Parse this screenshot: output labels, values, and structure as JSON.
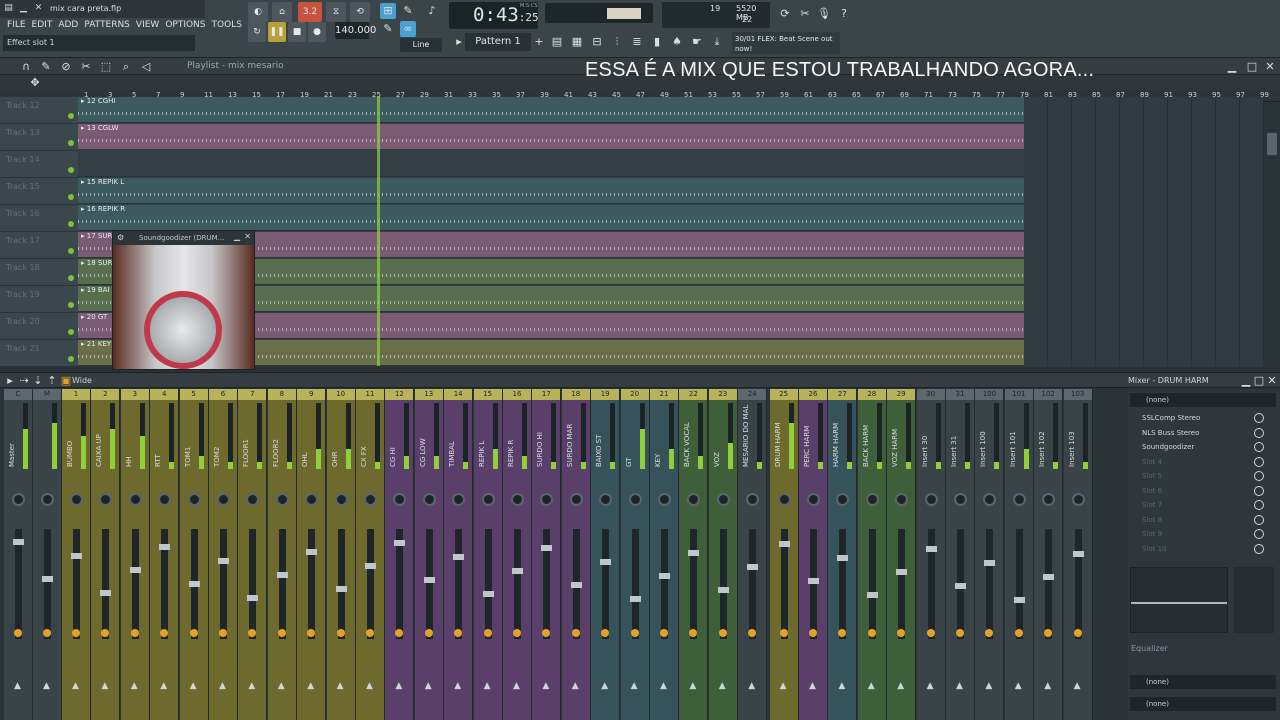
{
  "window": {
    "title": "mix cara preta.flp"
  },
  "menu": [
    "FILE",
    "EDIT",
    "ADD",
    "PATTERNS",
    "VIEW",
    "OPTIONS",
    "TOOLS",
    "?"
  ],
  "hint_bar": "Effect slot 1",
  "transport": {
    "time": "0:43",
    "time_frac": "25",
    "time_unit": "M:S:CS",
    "tempo": "140.000",
    "pattern": "Pattern 1",
    "snap": "Line",
    "step": "3.2"
  },
  "cpu": {
    "value": "19",
    "memory": "5520 MB",
    "polyphony": "22"
  },
  "hint_right": {
    "line1": "30/01 FLEX: Beat Scene out",
    "line2": "now!"
  },
  "playlist": {
    "title": "Playlist - mix mesario",
    "ruler": [
      "1",
      "3",
      "5",
      "7",
      "9",
      "11",
      "13",
      "15",
      "17",
      "19",
      "21",
      "23",
      "25",
      "27",
      "29",
      "31",
      "33",
      "35",
      "37",
      "39",
      "41",
      "43",
      "45",
      "47",
      "49",
      "51",
      "53",
      "55",
      "57",
      "59",
      "61",
      "63",
      "65",
      "67",
      "69",
      "71",
      "73",
      "75",
      "77",
      "79",
      "81",
      "83",
      "85",
      "87",
      "89",
      "91",
      "93",
      "95",
      "97",
      "99"
    ],
    "tracks": [
      {
        "name": "Track 12",
        "clip": "12 CGHI",
        "color": "#3c5a5f"
      },
      {
        "name": "Track 13",
        "clip": "13 CGLW",
        "color": "#7a5b73"
      },
      {
        "name": "Track 14",
        "clip": "",
        "color": "#324046"
      },
      {
        "name": "Track 15",
        "clip": "15 REPIK L",
        "color": "#3c5a5f"
      },
      {
        "name": "Track 16",
        "clip": "16 REPIK R",
        "color": "#3c5a5f"
      },
      {
        "name": "Track 17",
        "clip": "17 SUR",
        "color": "#7a5b73"
      },
      {
        "name": "Track 18",
        "clip": "18 SUR",
        "color": "#596e4f"
      },
      {
        "name": "Track 19",
        "clip": "19 BAI",
        "color": "#596e4f"
      },
      {
        "name": "Track 20",
        "clip": "20 GT",
        "color": "#7a5b73"
      },
      {
        "name": "Track 21",
        "clip": "21 KEY",
        "color": "#6a6e4a"
      }
    ]
  },
  "overlay_text": "ESSA É A MIX QUE ESTOU TRABALHANDO AGORA...",
  "plugin": {
    "title": "Soundgoodizer (DRUM..."
  },
  "mixer": {
    "mode": "Wide",
    "title": "Mixer - DRUM HARM",
    "selected": "(none)",
    "bottom": "(none)",
    "eq_label": "Equalizer",
    "slot_none": "(none)",
    "slots": [
      {
        "name": "SSLComp Stereo",
        "on": true
      },
      {
        "name": "NLS Buss Stereo",
        "on": true
      },
      {
        "name": "Soundgoodizer",
        "on": true
      },
      {
        "name": "Slot 4",
        "on": false
      },
      {
        "name": "Slot 5",
        "on": false
      },
      {
        "name": "Slot 6",
        "on": false
      },
      {
        "name": "Slot 7",
        "on": false
      },
      {
        "name": "Slot 8",
        "on": false
      },
      {
        "name": "Slot 9",
        "on": false
      },
      {
        "name": "Slot 10",
        "on": false
      }
    ],
    "strips": [
      {
        "n": "C",
        "name": "Master",
        "color": "#3a4348",
        "level": 0.6
      },
      {
        "n": "M",
        "name": "",
        "color": "#3a4348",
        "level": 0.7
      },
      {
        "n": "1",
        "name": "BUMBO",
        "color": "#6e6a2e",
        "level": 0.5
      },
      {
        "n": "2",
        "name": "CAIXA UP",
        "color": "#6e6a2e",
        "level": 0.6
      },
      {
        "n": "3",
        "name": "HH",
        "color": "#6e6a2e",
        "level": 0.5
      },
      {
        "n": "4",
        "name": "RTT",
        "color": "#6e6a2e",
        "level": 0.1
      },
      {
        "n": "5",
        "name": "TOM1",
        "color": "#6e6a2e",
        "level": 0.2
      },
      {
        "n": "6",
        "name": "TOM2",
        "color": "#6e6a2e",
        "level": 0.1
      },
      {
        "n": "7",
        "name": "FLOOR1",
        "color": "#6e6a2e",
        "level": 0.1
      },
      {
        "n": "8",
        "name": "FLOOR2",
        "color": "#6e6a2e",
        "level": 0.1
      },
      {
        "n": "9",
        "name": "OHL",
        "color": "#6e6a2e",
        "level": 0.3
      },
      {
        "n": "10",
        "name": "OHR",
        "color": "#6e6a2e",
        "level": 0.3
      },
      {
        "n": "11",
        "name": "CX FX",
        "color": "#6e6a2e",
        "level": 0.1
      },
      {
        "n": "12",
        "name": "CG HI",
        "color": "#5a3f6a",
        "level": 0.2
      },
      {
        "n": "13",
        "name": "CG LOW",
        "color": "#5a3f6a",
        "level": 0.2
      },
      {
        "n": "14",
        "name": "TIMBAL",
        "color": "#5a3f6a",
        "level": 0.1
      },
      {
        "n": "15",
        "name": "REPIK L",
        "color": "#5a3f6a",
        "level": 0.3
      },
      {
        "n": "16",
        "name": "REPIK R",
        "color": "#5a3f6a",
        "level": 0.2
      },
      {
        "n": "17",
        "name": "SURDO HI",
        "color": "#5a3f6a",
        "level": 0.1
      },
      {
        "n": "18",
        "name": "SURDO MAR",
        "color": "#5a3f6a",
        "level": 0.1
      },
      {
        "n": "19",
        "name": "BAIXO ST",
        "color": "#36525a",
        "level": 0.1
      },
      {
        "n": "20",
        "name": "GT",
        "color": "#36525a",
        "level": 0.6
      },
      {
        "n": "21",
        "name": "KEY",
        "color": "#36525a",
        "level": 0.3
      },
      {
        "n": "22",
        "name": "BACK VOCAL",
        "color": "#3f5e3a",
        "level": 0.2
      },
      {
        "n": "23",
        "name": "VOZ",
        "color": "#3f5e3a",
        "level": 0.4
      },
      {
        "n": "24",
        "name": "MESARIO DO MAL",
        "color": "#3a4348",
        "level": 0.1
      },
      {
        "n": "25",
        "name": "DRUM HARM",
        "color": "#6e6a2e",
        "level": 0.7
      },
      {
        "n": "26",
        "name": "PERC HARM",
        "color": "#5a3f6a",
        "level": 0.1
      },
      {
        "n": "27",
        "name": "HARM HARM",
        "color": "#36525a",
        "level": 0.1
      },
      {
        "n": "28",
        "name": "BACK HARM",
        "color": "#3f5e3a",
        "level": 0.1
      },
      {
        "n": "29",
        "name": "VOZ HARM",
        "color": "#3f5e3a",
        "level": 0.1
      },
      {
        "n": "30",
        "name": "Insert 30",
        "color": "#3a4348",
        "level": 0.1
      },
      {
        "n": "31",
        "name": "Insert 31",
        "color": "#3a4348",
        "level": 0.1
      },
      {
        "n": "100",
        "name": "Insert 100",
        "color": "#3a4348",
        "level": 0.1
      },
      {
        "n": "101",
        "name": "Insert 101",
        "color": "#3a4348",
        "level": 0.3
      },
      {
        "n": "102",
        "name": "Insert 102",
        "color": "#3a4348",
        "level": 0.1
      },
      {
        "n": "103",
        "name": "Insert 103",
        "color": "#3a4348",
        "level": 0.1
      }
    ]
  }
}
